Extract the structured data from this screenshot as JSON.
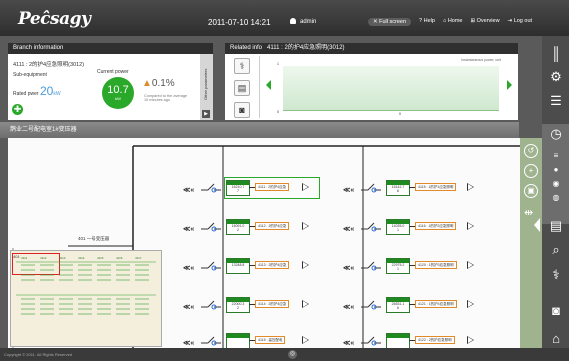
{
  "header": {
    "logo": "Peĉsagy",
    "datetime": "2011-07-10 14:21",
    "user": "admin",
    "nav": [
      "Full screen",
      "Help",
      "Home",
      "Overview",
      "Log out"
    ]
  },
  "branch": {
    "title": "Branch information",
    "name": "4111 : 2的护4应急照明(3012)",
    "sub_label": "Sub-equipment",
    "rated_label": "Rated pwer",
    "rated_value": "20",
    "rated_unit": "kW",
    "current_label": "Current power",
    "current_value": "10.7",
    "current_unit": "kW",
    "change_pct": "0.1%",
    "compare_text": "Compared to the average 10 minutes ago",
    "other_params": "Other parameters"
  },
  "related": {
    "title": "Related info",
    "name": "4111 : 2的护4应急照明(3012)",
    "chart_legend": "Instantaneous power, unit",
    "y_top": "1",
    "y_bottom": "0",
    "x_zero": "0"
  },
  "diagram": {
    "strip_title": "鹊业二号配电室1#变压器",
    "bus_label": "401 一号变压器",
    "rows": [
      {
        "left_value": "16210.7\n7",
        "left_label": "4111 : 2的护4应急",
        "right_value": "16142.7\n6",
        "right_label": "4115 : 1的护1应急照明"
      },
      {
        "left_value": "16091.0\n2",
        "left_label": "4112 : 2的护4应急",
        "right_value": "14035.0\n1",
        "right_label": "4116 : 1的护2应急照明"
      },
      {
        "left_value": "13248.8",
        "left_label": "4113 : 2的护4应急",
        "right_value": "22975.2\n1",
        "right_label": "4120 : 1的护3应急照明"
      },
      {
        "left_value": "22000.3\n2",
        "left_label": "4114 : 2的护4应急",
        "right_value": "26531.1\n6",
        "right_label": "4121 : 1的护4应急照明"
      },
      {
        "left_value": "",
        "left_label": "4115 : 高压配电",
        "right_value": "",
        "right_label": "4122 : 2的护应急照明"
      }
    ]
  },
  "minimap": {
    "label": "401",
    "cols": [
      "4111",
      "4112",
      "4113",
      "4114",
      "4115",
      "4116",
      "4117"
    ]
  },
  "footer": {
    "copyright": "Copyright © 2011. All Rights Reserved"
  },
  "sidebar": {
    "items": [
      "Monitor",
      "Parameters",
      "Reports",
      "Equipment",
      "Print",
      "Query",
      "Settings",
      "Camera",
      "Home"
    ]
  },
  "colors": {
    "accent_green": "#2aa82a",
    "topbar": "#333333",
    "orange": "#e08a2a"
  }
}
